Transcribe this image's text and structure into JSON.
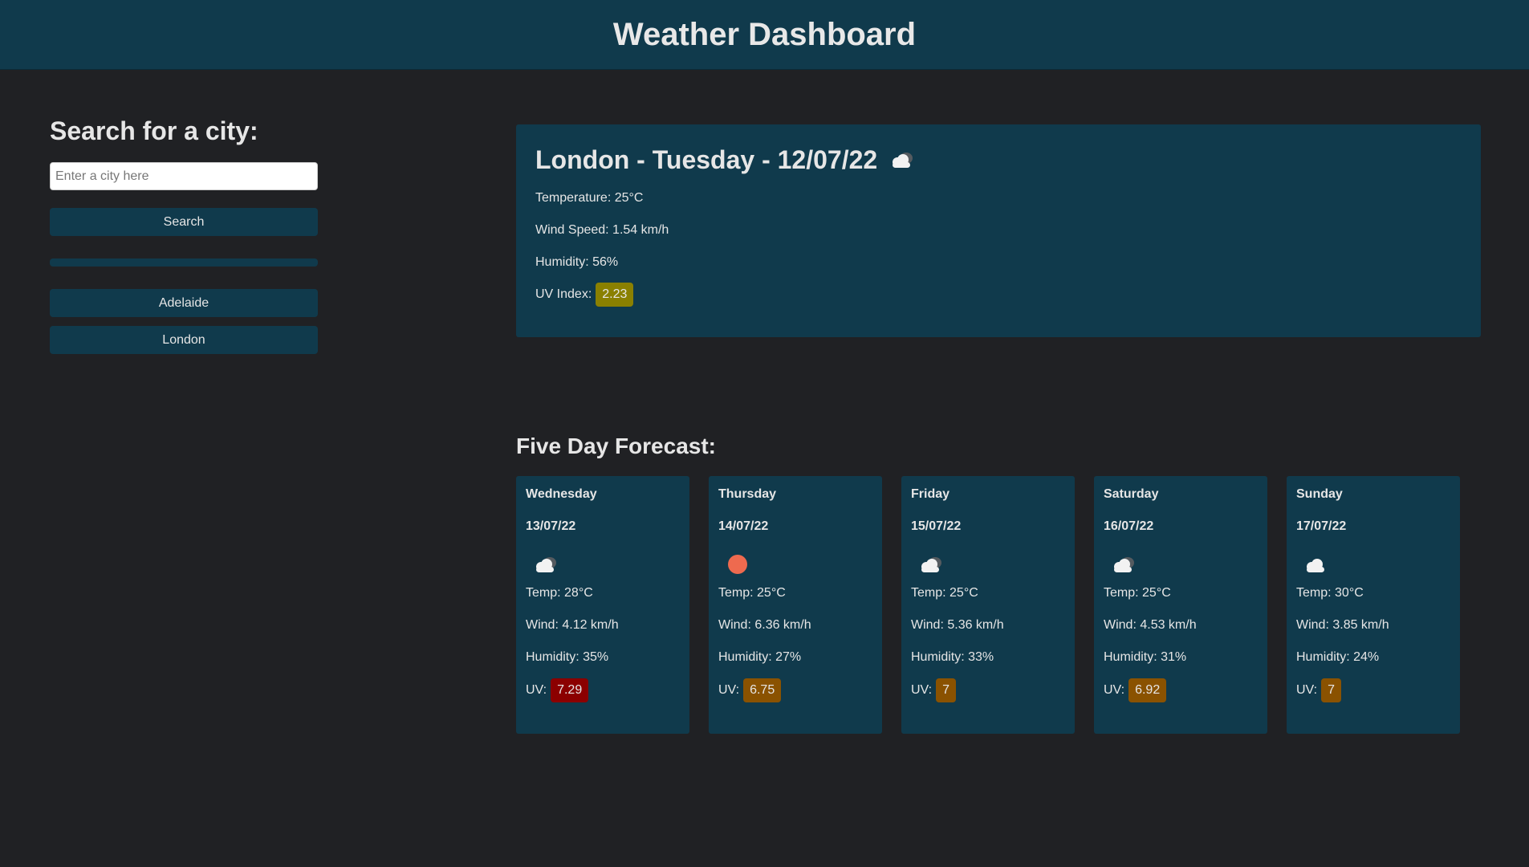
{
  "header": {
    "title": "Weather Dashboard"
  },
  "sidebar": {
    "heading": "Search for a city:",
    "search_placeholder": "Enter a city here",
    "search_label": "Search",
    "history": [
      "Adelaide",
      "London"
    ]
  },
  "current": {
    "title": "London - Tuesday - 12/07/22",
    "icon": "cloud-icon",
    "temperature": "Temperature: 25°C",
    "wind": "Wind Speed: 1.54 km/h",
    "humidity": "Humidity: 56%",
    "uv_label": "UV Index:",
    "uv_value": "2.23",
    "uv_color": "#8a8000"
  },
  "forecast": {
    "title": "Five Day Forecast:",
    "days": [
      {
        "day": "Wednesday",
        "date": "13/07/22",
        "icon": "cloud-icon",
        "temp": "Temp: 28°C",
        "wind": "Wind: 4.12 km/h",
        "humidity": "Humidity: 35%",
        "uv_label": "UV:",
        "uv": "7.29",
        "uv_color": "#8b0000"
      },
      {
        "day": "Thursday",
        "date": "14/07/22",
        "icon": "sun-icon",
        "temp": "Temp: 25°C",
        "wind": "Wind: 6.36 km/h",
        "humidity": "Humidity: 27%",
        "uv_label": "UV:",
        "uv": "6.75",
        "uv_color": "#8a5200"
      },
      {
        "day": "Friday",
        "date": "15/07/22",
        "icon": "cloud-icon",
        "temp": "Temp: 25°C",
        "wind": "Wind: 5.36 km/h",
        "humidity": "Humidity: 33%",
        "uv_label": "UV:",
        "uv": "7",
        "uv_color": "#8a5200"
      },
      {
        "day": "Saturday",
        "date": "16/07/22",
        "icon": "cloud-icon",
        "temp": "Temp: 25°C",
        "wind": "Wind: 4.53 km/h",
        "humidity": "Humidity: 31%",
        "uv_label": "UV:",
        "uv": "6.92",
        "uv_color": "#8a5200"
      },
      {
        "day": "Sunday",
        "date": "17/07/22",
        "icon": "cloud-icon",
        "temp": "Temp: 30°C",
        "wind": "Wind: 3.85 km/h",
        "humidity": "Humidity: 24%",
        "uv_label": "UV:",
        "uv": "7",
        "uv_color": "#8a5200"
      }
    ]
  }
}
